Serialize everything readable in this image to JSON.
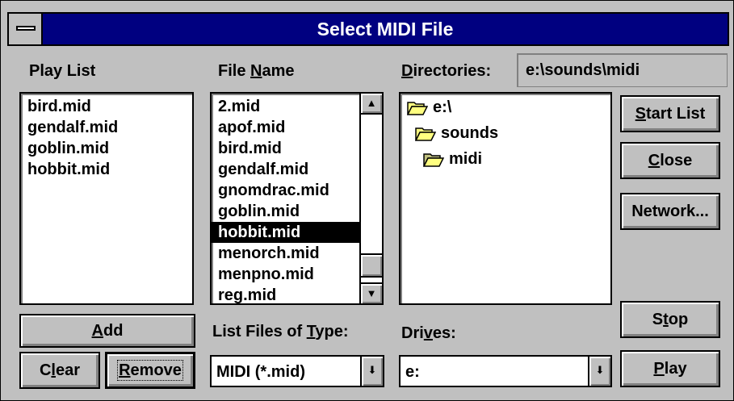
{
  "window": {
    "title": "Select MIDI File"
  },
  "playlist": {
    "label": "Play List",
    "items": [
      "bird.mid",
      "gendalf.mid",
      "goblin.mid",
      "hobbit.mid"
    ]
  },
  "filename": {
    "label_pre": "File ",
    "label_u": "N",
    "label_post": "ame",
    "items": [
      "2.mid",
      "apof.mid",
      "bird.mid",
      "gendalf.mid",
      "gnomdrac.mid",
      "goblin.mid",
      "hobbit.mid",
      "menorch.mid",
      "menpno.mid",
      "reg.mid"
    ],
    "selected_index": 6
  },
  "directories": {
    "label_u": "D",
    "label_post": "irectories:",
    "path": "e:\\sounds\\midi",
    "tree": [
      "e:\\",
      "sounds",
      "midi"
    ]
  },
  "buttons": {
    "start_list": {
      "u": "S",
      "rest": "tart List"
    },
    "close": {
      "u": "C",
      "rest": "lose"
    },
    "network": {
      "label": "Network..."
    },
    "stop": {
      "pre": "S",
      "u": "t",
      "rest": "op"
    },
    "play": {
      "u": "P",
      "rest": "lay"
    },
    "add": {
      "u": "A",
      "rest": "dd"
    },
    "clear": {
      "pre": "C",
      "u": "l",
      "rest": "ear"
    },
    "remove": {
      "u": "R",
      "rest": "emove"
    }
  },
  "filetype": {
    "label_pre": "List Files of ",
    "label_u": "T",
    "label_post": "ype:",
    "value": "MIDI (*.mid)"
  },
  "drives": {
    "label_pre": "Dri",
    "label_u": "v",
    "label_post": "es:",
    "value": "e:"
  },
  "icons": {
    "arrow_up": "▲",
    "arrow_down": "▼",
    "combo_arrow": "⬇"
  }
}
